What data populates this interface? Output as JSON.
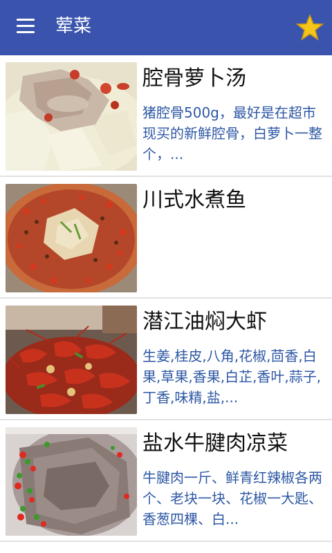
{
  "appbar": {
    "title": "荤菜",
    "menu_icon": "menu-icon",
    "favorite_icon": "star-icon",
    "color": "#3a54ad",
    "star_color": "#f5c518"
  },
  "dishes": [
    {
      "name": "腔骨萝卜汤",
      "desc": "猪腔骨500g，最好是在超市现买的新鲜腔骨，白萝卜一整个，..."
    },
    {
      "name": "川式水煮鱼",
      "desc": ""
    },
    {
      "name": "潜江油焖大虾",
      "desc": "生姜,桂皮,八角,花椒,茴香,白果,草果,香果,白芷,香叶,蒜子,丁香,味精,盐,..."
    },
    {
      "name": "盐水牛腱肉凉菜",
      "desc": "牛腱肉一斤、鲜青红辣椒各两个、老块一块、花椒一大匙、香葱四棵、白..."
    }
  ],
  "colors": {
    "name_text": "#111111",
    "desc_text": "#2d57a4",
    "divider": "#e1e1e1"
  }
}
